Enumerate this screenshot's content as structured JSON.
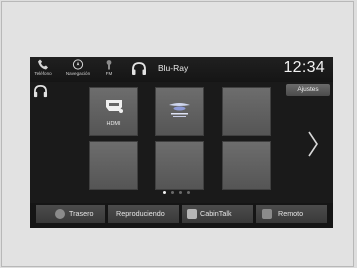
{
  "nav": {
    "phone": "Teléfono",
    "navigation": "Navegación",
    "fm": "FM"
  },
  "header": {
    "source": "Blu-Ray",
    "clock": "12:34"
  },
  "settings_label": "Ajustes",
  "tiles": [
    {
      "label": "HDMI"
    },
    {
      "label": ""
    }
  ],
  "page_indicator": {
    "count": 4,
    "active": 0
  },
  "bottom": {
    "rear": "Trasero",
    "now_playing": "Reproduciendo",
    "cabintalk": "CabinTalk",
    "remote": "Remoto"
  }
}
